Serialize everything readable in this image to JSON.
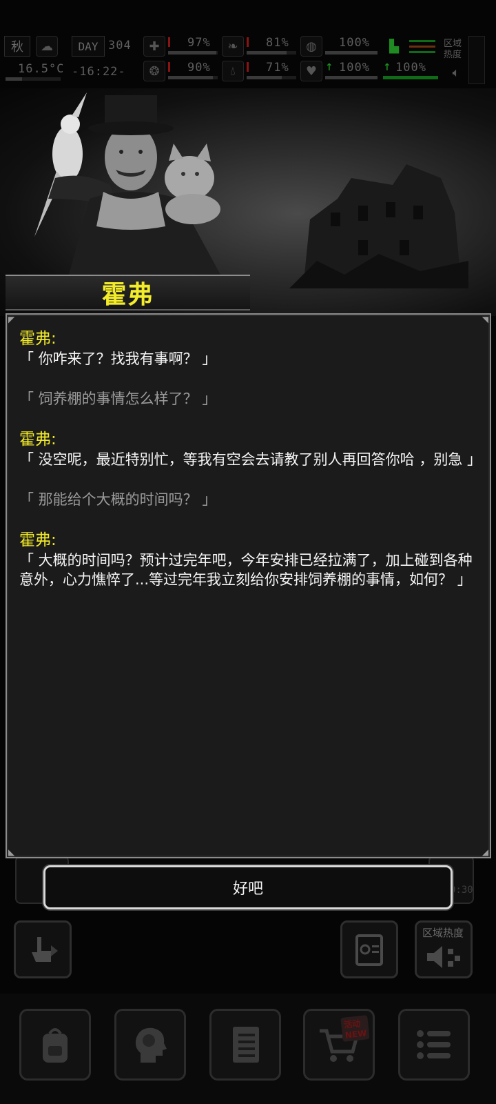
{
  "status": {
    "season": "秋",
    "day_label": "DAY",
    "day_value": "304",
    "temperature": "16.5°C",
    "time": "-16:22-",
    "stats_top": [
      "97%",
      "81%",
      "100%"
    ],
    "stats_bottom": [
      "90%",
      "71%",
      "100%",
      "100%"
    ],
    "zone_label": "区域热度"
  },
  "npc": {
    "name": "霍弗"
  },
  "dialog": {
    "entries": [
      {
        "speaker": "霍弗:",
        "text": "「 你咋来了？找我有事啊？ 」"
      },
      {
        "choice": "「 饲养棚的事情怎么样了？ 」"
      },
      {
        "speaker": "霍弗:",
        "text": "「 没空呢，最近特别忙，等我有空会去请教了别人再回答你哈 ，别急 」"
      },
      {
        "choice": "「 那能给个大概的时间吗？ 」"
      },
      {
        "speaker": "霍弗:",
        "text": "「 大概的时间吗？预计过完年吧，今年安排已经拉满了，加上碰到各种意外，心力憔悴了...等过完年我立刻给你安排饲养棚的事情，如何？ 」"
      }
    ]
  },
  "confirm_button": "好吧",
  "hud": {
    "zone_heat_label": "区域热度",
    "time_fragment": "0:30"
  },
  "bottom_nav": {
    "new_badge": "NEW",
    "event_badge": "活动"
  },
  "colors": {
    "speaker": "#f0ea28",
    "choice": "#9b9b9b",
    "panel": "#1b1b1b"
  }
}
